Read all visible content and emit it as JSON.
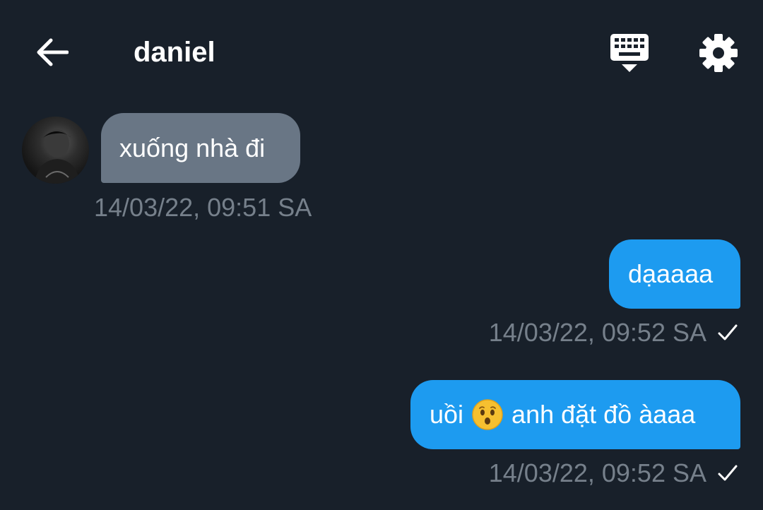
{
  "header": {
    "title": "daniel",
    "back_icon": "arrow-left-icon",
    "keyboard_icon": "keyboard-icon",
    "settings_icon": "gear-icon"
  },
  "messages": [
    {
      "direction": "incoming",
      "text": "xuống nhà đi",
      "timestamp": "14/03/22, 09:51 SA"
    },
    {
      "direction": "outgoing",
      "text": "dạaaaa",
      "timestamp": "14/03/22, 09:52 SA",
      "status": "sent"
    },
    {
      "direction": "outgoing",
      "text_before_emoji": "uồi",
      "emoji": "hushed-face-emoji",
      "text_after_emoji": "anh đặt đồ àaaa",
      "timestamp": "14/03/22, 09:52 SA",
      "status": "sent"
    }
  ],
  "colors": {
    "background": "#18202a",
    "incoming_bubble": "#697685",
    "outgoing_bubble": "#1d9bf0",
    "timestamp": "#76808b"
  }
}
